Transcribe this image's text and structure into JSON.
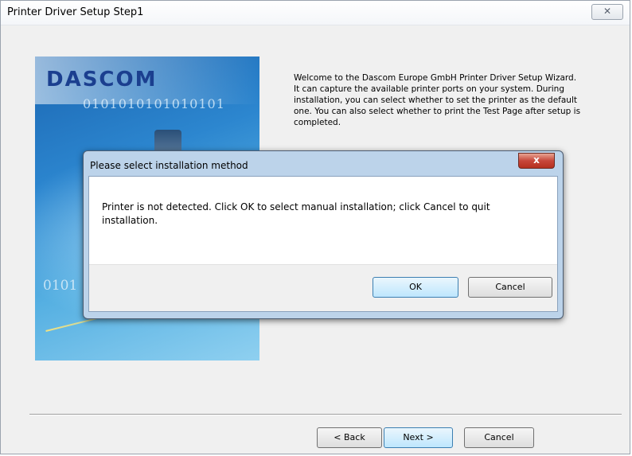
{
  "window": {
    "title": "Printer Driver Setup Step1",
    "close_glyph": "✕"
  },
  "hero": {
    "logo_text": "DASCOM",
    "binary_top": "0101010101010101",
    "binary_bottom": "0101"
  },
  "welcome_text": "Welcome to the Dascom Europe GmbH Printer Driver Setup Wizard. It can capture the available printer ports on your system. During installation, you can select whether to set the printer as the default one. You can also select whether to print the Test Page after setup is completed.",
  "buttons": {
    "back": "< Back",
    "next": "Next >",
    "cancel": "Cancel"
  },
  "dialog": {
    "title": "Please select installation method",
    "close_glyph": "x",
    "message": "Printer is not detected. Click OK to select manual installation; click Cancel to quit installation.",
    "ok": "OK",
    "cancel": "Cancel"
  },
  "colors": {
    "accent": "#3c7fb1",
    "dialog_frame": "#bcd3ea",
    "close_red": "#c7463a"
  }
}
